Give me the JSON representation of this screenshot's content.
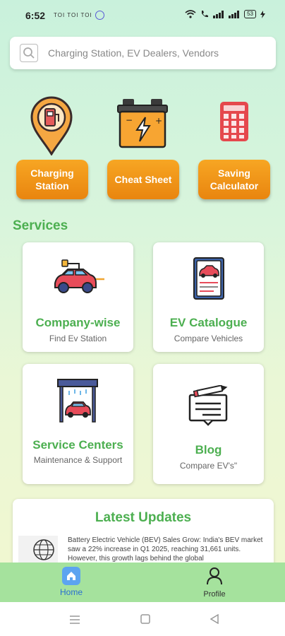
{
  "status_bar": {
    "time": "6:52",
    "carriers": "TOI TOI TOI",
    "battery": "53"
  },
  "search": {
    "placeholder": "Charging Station, EV Dealers, Vendors"
  },
  "quick_actions": [
    {
      "label": "Charging Station",
      "icon": "location-pin-charger-icon"
    },
    {
      "label": "Cheat Sheet",
      "icon": "battery-icon"
    },
    {
      "label": "Saving Calculator",
      "icon": "calculator-icon"
    }
  ],
  "services": {
    "title": "Services",
    "cards": [
      {
        "title": "Company-wise",
        "subtitle": "Find Ev Station",
        "icon": "car-charging-icon"
      },
      {
        "title": "EV Catalogue",
        "subtitle": "Compare Vehicles",
        "icon": "catalogue-icon"
      },
      {
        "title": "Service Centers",
        "subtitle": "Maintenance & Support",
        "icon": "garage-icon"
      },
      {
        "title": "Blog",
        "subtitle": "Compare EV's\"",
        "icon": "blog-icon"
      }
    ]
  },
  "updates": {
    "title": "Latest Updates",
    "item_text": "Battery Electric Vehicle (BEV) Sales Grow: India's BEV market saw a 22% increase in Q1 2025, reaching 31,661 units. However, this growth lags behind the global",
    "item_icon": "globe-icon"
  },
  "bottom_nav": {
    "home": "Home",
    "profile": "Profile"
  },
  "colors": {
    "accent_green": "#4caf50",
    "button_orange": "#f29418",
    "nav_green": "#a5e29d",
    "home_blue": "#5ca4f0"
  }
}
